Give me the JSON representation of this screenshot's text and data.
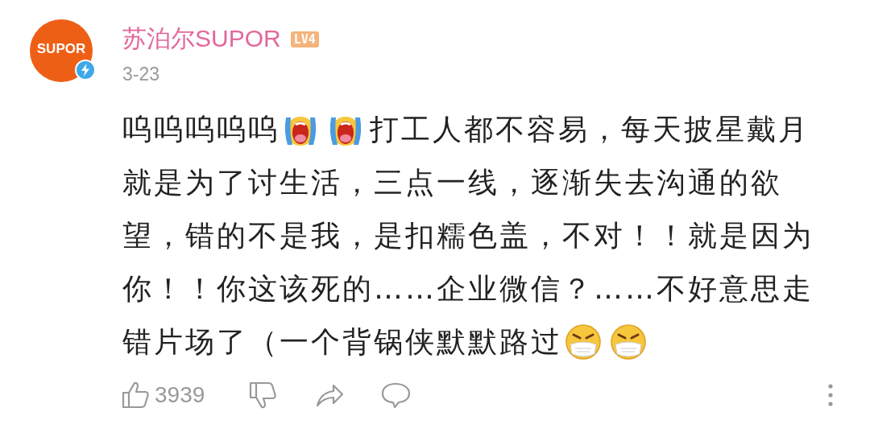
{
  "comment": {
    "avatar": {
      "logo_text": "SUPOR",
      "verified": true
    },
    "author": "苏泊尔SUPOR",
    "level_badge": "LV4",
    "date": "3-23",
    "lines": [
      [
        {
          "kind": "text",
          "text": "呜呜呜呜呜"
        },
        {
          "kind": "crying"
        },
        {
          "kind": "crying"
        },
        {
          "kind": "text",
          "text": "打工人都不容易，每天披星戴月"
        }
      ],
      [
        {
          "kind": "text",
          "text": "就是为了讨生活，三点一线，逐渐失去沟通的欲"
        }
      ],
      [
        {
          "kind": "text",
          "text": "望，错的不是我，是扣糯色盖，不对！！就是因为"
        }
      ],
      [
        {
          "kind": "text",
          "text": "你！！你这该死的……企业微信？……不好意思走"
        }
      ],
      [
        {
          "kind": "text",
          "text": "错片场了（一个背锅侠默默路过"
        },
        {
          "kind": "masked"
        },
        {
          "kind": "masked"
        }
      ]
    ],
    "actions": [
      {
        "kind": "like",
        "count": "3939"
      },
      {
        "kind": "dislike"
      },
      {
        "kind": "share"
      },
      {
        "kind": "reply"
      },
      {
        "kind": "more"
      }
    ]
  }
}
